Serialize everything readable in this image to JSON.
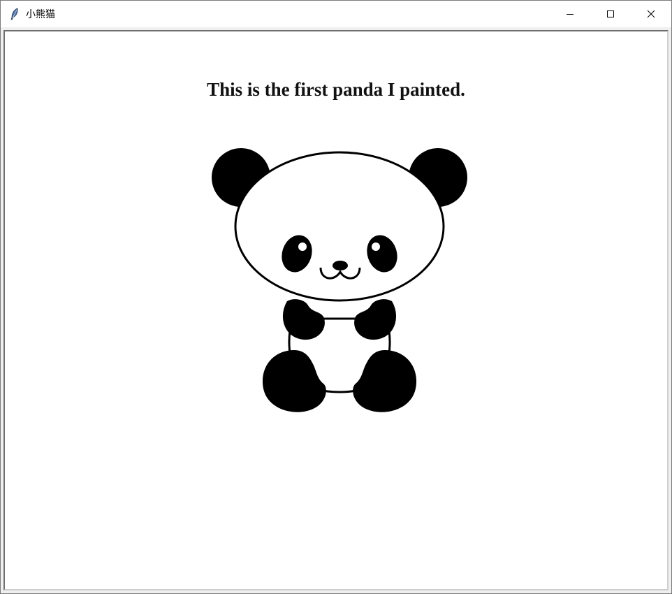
{
  "window": {
    "title": "小熊猫",
    "icon": "feather-icon",
    "controls": [
      "minimize-icon",
      "maximize-icon",
      "close-icon"
    ]
  },
  "canvas": {
    "caption": "This is the first panda I painted.",
    "background": "#ffffff"
  },
  "colors": {
    "ink": "#000000",
    "title_text": "#000000"
  }
}
